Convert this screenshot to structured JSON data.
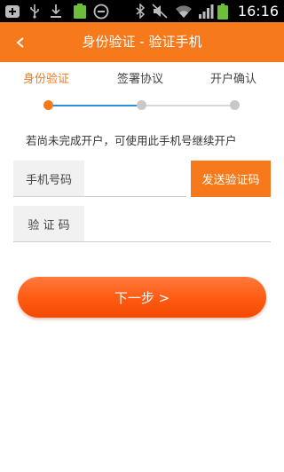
{
  "status_bar": {
    "time": "16:16",
    "icons": [
      "add-box-icon",
      "usb-icon",
      "download-icon",
      "battery-100-icon",
      "no-entry-icon",
      "bluetooth-icon",
      "mute-icon",
      "wifi-icon",
      "signal-icon",
      "battery-charging-icon"
    ],
    "battery_small_label": "100%"
  },
  "header": {
    "back_label": "<",
    "title": "身份验证 - 验证手机"
  },
  "steps": {
    "items": [
      {
        "label": "身份验证",
        "state": "active"
      },
      {
        "label": "签署协议",
        "state": "inactive"
      },
      {
        "label": "开户确认",
        "state": "inactive"
      }
    ]
  },
  "hint": "若尚未完成开户，可使用此手机号继续开户",
  "form": {
    "phone_label": "手机号码",
    "phone_value": "",
    "send_code_label": "发送验证码",
    "code_label": "验 证 码",
    "code_value": ""
  },
  "next_button_label": "下一步 >",
  "colors": {
    "accent": "#f6791b",
    "step_inactive": "#c8c8c8",
    "line_active": "#2f8fd6"
  }
}
